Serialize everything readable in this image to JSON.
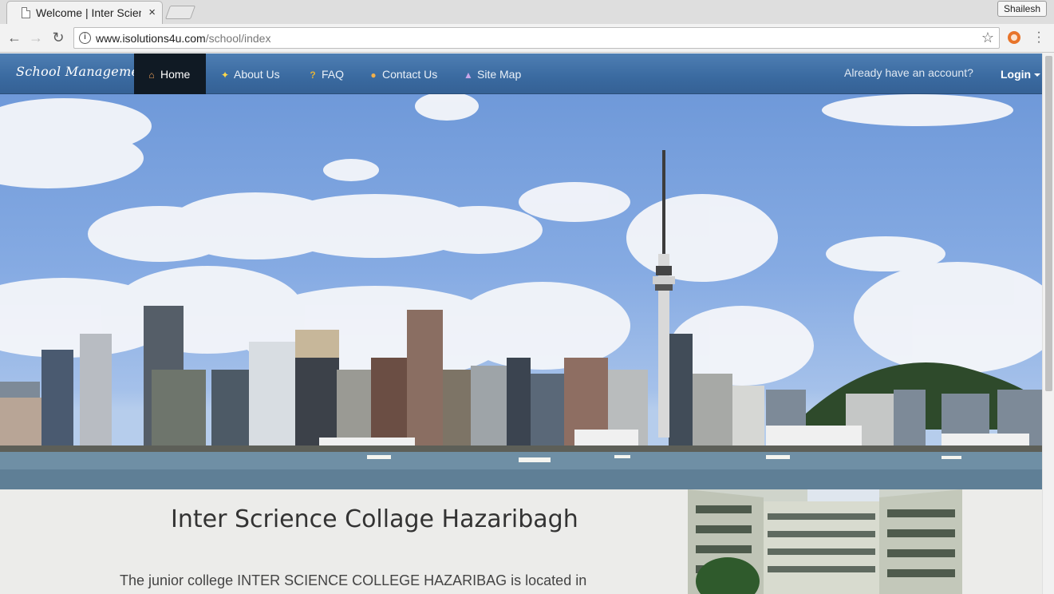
{
  "browser": {
    "tab_title": "Welcome | Inter Science",
    "tab_close": "×",
    "profile_name": "Shailesh",
    "url_host": "www.isolutions4u.com",
    "url_path": "/school/index",
    "icons": [
      "doc-icon",
      "back-icon",
      "forward-icon",
      "reload-icon",
      "info-icon",
      "star-icon",
      "extension-icon",
      "menu-icon"
    ]
  },
  "navbar": {
    "brand": "School Management",
    "items": [
      {
        "label": "Home",
        "icon": "house-icon",
        "active": true
      },
      {
        "label": "About Us",
        "icon": "sparkle-icon"
      },
      {
        "label": "FAQ",
        "icon": "question-icon"
      },
      {
        "label": "Contact Us",
        "icon": "people-icon"
      },
      {
        "label": "Site Map",
        "icon": "sitemap-icon"
      }
    ],
    "account_prompt": "Already have an account?",
    "login_label": "Login"
  },
  "content": {
    "title": "Inter Scrience Collage Hazaribagh",
    "description": "The junior college INTER SCIENCE COLLEGE HAZARIBAG is located in"
  },
  "colors": {
    "navbar": "#3f6fa5",
    "active_nav": "#101a24",
    "content_bg": "#ececea"
  }
}
